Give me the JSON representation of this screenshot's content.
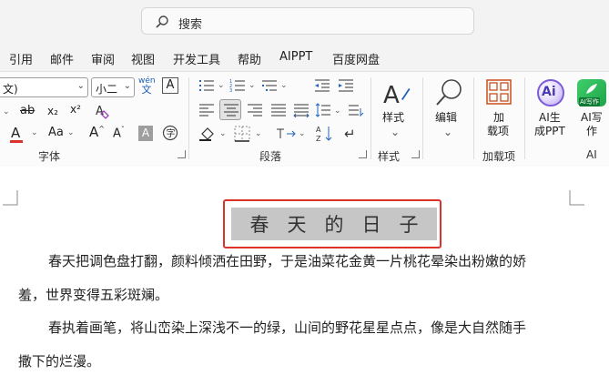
{
  "search": {
    "placeholder": "搜索"
  },
  "menu": {
    "tabs": [
      "引用",
      "邮件",
      "审阅",
      "视图",
      "开发工具",
      "帮助",
      "AIPPT",
      "百度网盘"
    ]
  },
  "font": {
    "font_name": "文)",
    "font_size": "小二",
    "wen_top": "wén",
    "wen_bottom": "文",
    "clear_char": "A",
    "strike": "ab",
    "sub": "x₂",
    "sup": "x²",
    "font_color_glyph": "A",
    "case_glyph": "Aa",
    "grow": "A",
    "shrink": "A",
    "char_shading": "A",
    "group_label": "字体"
  },
  "paragraph": {
    "group_label": "段落"
  },
  "styles": {
    "button_label": "样式",
    "group_label": "样式"
  },
  "editing": {
    "button_label": "编辑"
  },
  "addins": {
    "button_label_1": "加",
    "button_label_2": "载项",
    "group_label": "加载项"
  },
  "ai": {
    "ppt_label_1": "AI生",
    "ppt_label_2": "成PPT",
    "write_label_1": "AI写",
    "write_label_2": "作",
    "ai_icon_text": "Ai",
    "write_badge": "AI写作",
    "group_label": "AI"
  },
  "document": {
    "title": "春天的日子",
    "para1_line1": "春天把调色盘打翻，颜料倾洒在田野，于是油菜花金黄一片桃花晕染出粉嫩的娇",
    "para1_line2": "羞，世界变得五彩斑斓。",
    "para2_line1": "春执着画笔，将山峦染上深浅不一的绿，山间的野花星星点点，像是大自然随手",
    "para2_line2": "撒下的烂漫。"
  },
  "colors": {
    "accent_red": "#d9332a",
    "highlight_gray": "#c6c6c6",
    "ribbon_bg": "#fbfbfb",
    "window_bg": "#f3f3f3"
  }
}
